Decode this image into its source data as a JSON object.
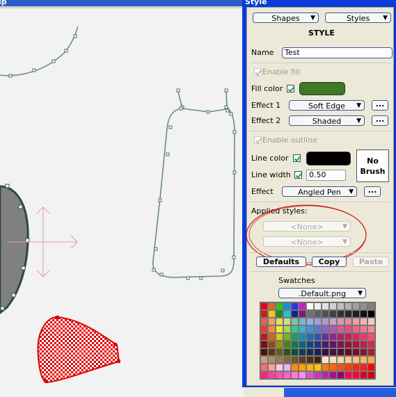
{
  "canvas": {
    "title_fragment": "ip"
  },
  "panel": {
    "title": "Style",
    "shapes_label": "Shapes",
    "styles_label": "Styles",
    "heading": "STYLE",
    "name_label": "Name",
    "name_value": "Test",
    "enable_fill_label": "Enable fill",
    "fill_color_label": "Fill color",
    "fill_color": "#3f7828",
    "effect1_label": "Effect 1",
    "effect1_value": "Soft Edge",
    "effect2_label": "Effect 2",
    "effect2_value": "Shaded",
    "enable_outline_label": "Enable outline",
    "line_color_label": "Line color",
    "line_color": "#000000",
    "line_width_label": "Line width",
    "line_width_value": "0.50",
    "no_brush_label": "No Brush",
    "effect_label": "Effect",
    "effect_value": "Angled Pen",
    "dots_label": "...",
    "applied_styles_label": "Applied styles:",
    "applied_style_1": "<None>",
    "applied_style_2": "<None>",
    "defaults_label": "Defaults",
    "copy_label": "Copy",
    "paste_label": "Paste",
    "swatches_label": "Swatches",
    "swatch_file": ".Default.png",
    "swatch_colors": [
      "#e6001e",
      "#e6641e",
      "#22c822",
      "#1e8cdc",
      "#3232e6",
      "#c81ec8",
      "#ffffff",
      "#f0f0f0",
      "#e0e0e0",
      "#d0d0d0",
      "#c0c0c0",
      "#b0b0b0",
      "#a0a0a0",
      "#909090",
      "#808080",
      "#c81e1e",
      "#f0c81e",
      "#1e8c1e",
      "#1ec8c8",
      "#1e1e96",
      "#781e78",
      "#707070",
      "#606060",
      "#505050",
      "#404040",
      "#303030",
      "#282828",
      "#202020",
      "#101010",
      "#000000",
      "#dc6450",
      "#f0a064",
      "#e6dc64",
      "#c8dc8c",
      "#78c8a0",
      "#78b4dc",
      "#8cb4e6",
      "#a0a0dc",
      "#b496d2",
      "#c8a0c8",
      "#dc96b4",
      "#e68ca0",
      "#f0a0a0",
      "#f0b4b4",
      "#f0c8c8",
      "#e63c3c",
      "#f08c3c",
      "#f0e63c",
      "#a0dc5a",
      "#3cc88c",
      "#3cb4d2",
      "#3c96dc",
      "#5a78d2",
      "#8c64c8",
      "#b45ab4",
      "#d25a96",
      "#e6507a",
      "#f0648c",
      "#f07896",
      "#f08ca0",
      "#b41e1e",
      "#d2641e",
      "#d2c81e",
      "#78b41e",
      "#1ea064",
      "#1e8cb4",
      "#1e6eb4",
      "#3c50b4",
      "#6432a0",
      "#8c288c",
      "#b41e6e",
      "#c81e50",
      "#dc285a",
      "#e63c64",
      "#f0506e",
      "#7a1010",
      "#9a4a10",
      "#9a9010",
      "#4a8010",
      "#107848",
      "#106480",
      "#104a80",
      "#283280",
      "#461e70",
      "#641464",
      "#801450",
      "#961432",
      "#aa1440",
      "#be1e4a",
      "#d22854",
      "#501010",
      "#643210",
      "#646010",
      "#325010",
      "#105030",
      "#104050",
      "#103050",
      "#1e1e50",
      "#32104a",
      "#461046",
      "#501032",
      "#641020",
      "#78102a",
      "#8c1432",
      "#a01e3c",
      "#c8a078",
      "#b48c64",
      "#a07850",
      "#8c643c",
      "#785028",
      "#643c1e",
      "#503214",
      "#3c2810",
      "#ffe6c8",
      "#ffdcb4",
      "#ffd2a0",
      "#ffc88c",
      "#ffbe78",
      "#ffb464",
      "#ffaa50",
      "#ff6e6e",
      "#ffa0a0",
      "#ffc8dc",
      "#e6b4ff",
      "#ff8c00",
      "#ffa500",
      "#ffb400",
      "#ffc800",
      "#ff7800",
      "#ff6400",
      "#ff5000",
      "#ff3c00",
      "#ff2800",
      "#ff1e1e",
      "#ff0000",
      "#ff1e8c",
      "#ff3ca0",
      "#ff50b4",
      "#ff64c8",
      "#ff78dc",
      "#ff8cf0",
      "#e650c8",
      "#c83cb4",
      "#b428a0",
      "#a0148c",
      "#8c0078",
      "#ff0050",
      "#ff003c",
      "#dc0028",
      "#c80014"
    ]
  }
}
